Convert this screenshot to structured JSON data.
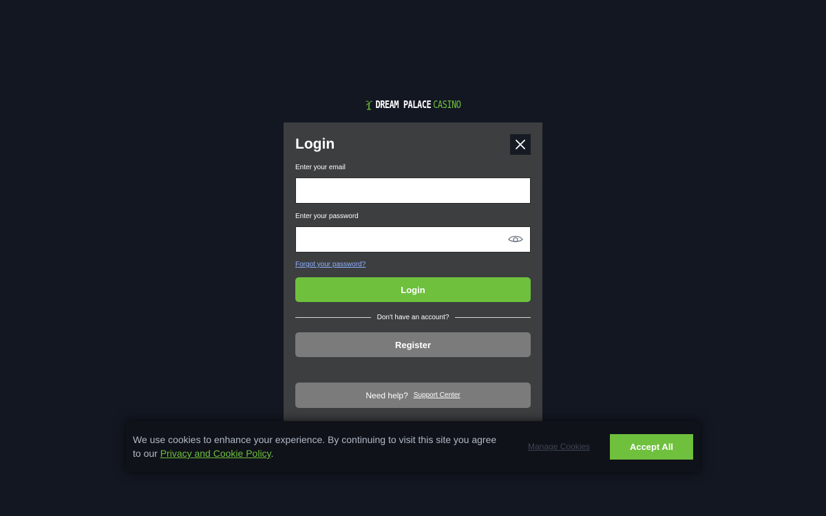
{
  "brand": {
    "name_main": "DREAM PALACE",
    "name_accent": "CASINO",
    "accent_color": "#6ec03d"
  },
  "modal": {
    "title": "Login",
    "email_label": "Enter your email",
    "email_value": "",
    "password_label": "Enter your password",
    "password_value": "",
    "forgot_link": "Forgot your password?",
    "login_button": "Login",
    "divider_text": "Don't have an account?",
    "register_button": "Register",
    "help_text": "Need help?",
    "support_link": "Support Center",
    "icons": {
      "close": "close-icon",
      "password_toggle": "eye-icon"
    }
  },
  "cookie_banner": {
    "text_before": "We use cookies to enhance your experience. By continuing to visit this site you agree to our ",
    "policy_link": "Privacy and Cookie Policy",
    "text_after": ".",
    "manage_link": "Manage Cookies",
    "accept_button": "Accept All"
  }
}
